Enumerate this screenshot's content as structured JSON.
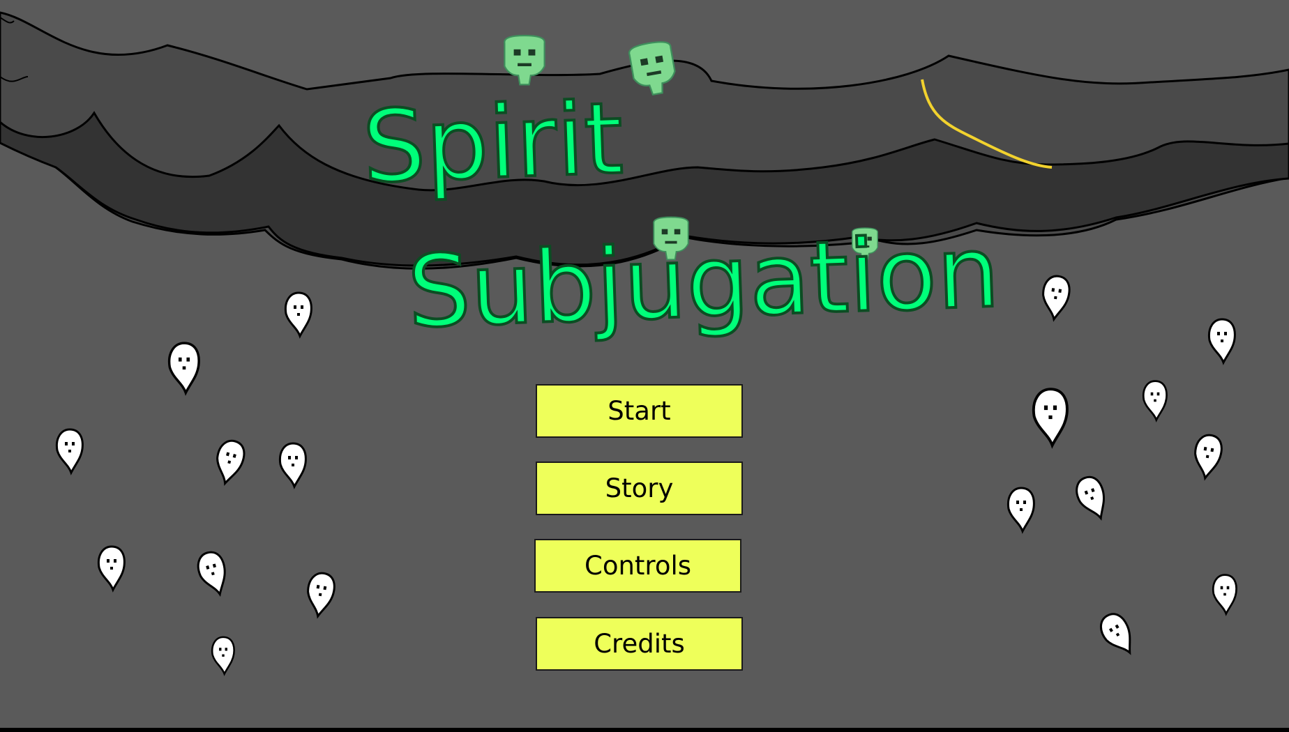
{
  "game": {
    "title": "Spirit Subjugation",
    "colors": {
      "background": "#5a5a5a",
      "cloud_light": "#4a4a4a",
      "cloud_dark": "#333333",
      "title_green": "#00ff7a",
      "skull_green": "#7fd98f",
      "lightning": "#f2d22e",
      "button": "#eeff5a",
      "ghost": "#ffffff"
    }
  },
  "menu": {
    "start_label": "Start",
    "story_label": "Story",
    "controls_label": "Controls",
    "credits_label": "Credits"
  },
  "decor": {
    "icons": [
      "storm-cloud-icon",
      "lightning-bolt-icon",
      "skull-icon",
      "ghost-icon"
    ]
  }
}
